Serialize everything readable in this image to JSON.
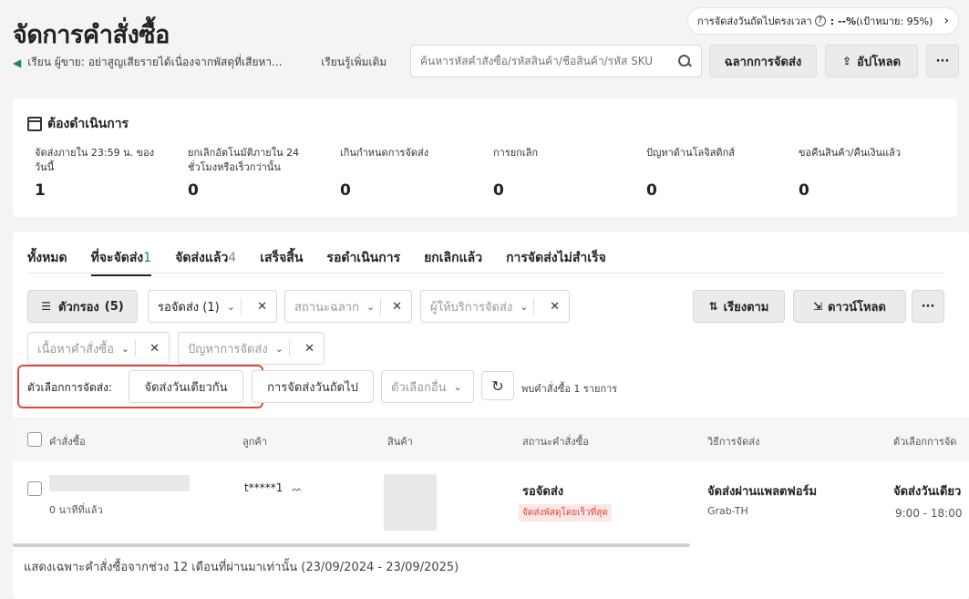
{
  "header": {
    "title": "จัดการคำสั่งซื้อ",
    "sla": {
      "label": "การจัดส่งวันถัดไปตรงเวลา",
      "help": "?",
      "value": ": --%",
      "target": " (เป้าหมาย: 95%)",
      "chevron": "›"
    },
    "notice": {
      "text": "เรียน ผู้ขาย: อย่าสูญเสียรายได้เนื่องจากพัสดุที่เสียหา...",
      "learn_more": "เรียนรู้เพิ่มเติม"
    },
    "search": {
      "placeholder": "ค้นหารหัสคำสั่งซื้อ/รหัสสินค้า/ชื่อสินค้า/รหัส SKU"
    },
    "buttons": {
      "label": "ฉลากการจัดส่ง",
      "upload": "อัปโหลด",
      "more": "···"
    }
  },
  "todo": {
    "title": "ต้องดำเนินการ",
    "items": [
      {
        "label": "จัดส่งภายใน 23:59 น. ของวันนี้",
        "value": "1"
      },
      {
        "label": "ยกเลิกอัตโนมัติภายใน 24 ชั่วโมงหรือเร็วกว่านั้น",
        "value": "0"
      },
      {
        "label": "เกินกำหนดการจัดส่ง",
        "value": "0"
      },
      {
        "label": "การยกเลิก",
        "value": "0"
      },
      {
        "label": "ปัญหาด้านโลจิสติกส์",
        "value": "0"
      },
      {
        "label": "ขอคืนสินค้า/คืนเงินแล้ว",
        "value": "0"
      }
    ]
  },
  "tabs": [
    {
      "label": "ทั้งหมด",
      "count": ""
    },
    {
      "label": "ที่จะจัดส่ง",
      "count": "1"
    },
    {
      "label": "จัดส่งแล้ว",
      "count": "4"
    },
    {
      "label": "เสร็จสิ้น",
      "count": ""
    },
    {
      "label": "รอดำเนินการ",
      "count": ""
    },
    {
      "label": "ยกเลิกแล้ว",
      "count": ""
    },
    {
      "label": "การจัดส่งไม่สำเร็จ",
      "count": ""
    }
  ],
  "filters": {
    "filter_button": "ตัวกรอง",
    "filter_count": "(5)",
    "to_ship": "รอจัดส่ง (1)",
    "label_status": "สถานะฉลาก",
    "provider": "ผู้ให้บริการจัดส่ง",
    "order_content": "เนื้อหาคำสั่งซื้อ",
    "shipping_issue": "ปัญหาการจัดส่ง",
    "sort": "เรียงตาม",
    "download": "ดาวน์โหลด",
    "more": "···"
  },
  "shipping_options": {
    "label": "ตัวเลือกการจัดส่ง:",
    "same_day": "จัดส่งวันเดียวกัน",
    "next_day": "การจัดส่งวันถัดไป",
    "other": "ตัวเลือกอื่น",
    "found": "พบคำสั่งซื้อ 1 รายการ"
  },
  "table": {
    "columns": [
      "คำสั่งซื้อ",
      "ลูกค้า",
      "สินค้า",
      "สถานะคำสั่งซื้อ",
      "วิธีการจัดส่ง",
      "ตัวเลือกการจัด"
    ],
    "rows": [
      {
        "time": "0 นาทีที่แล้ว",
        "customer": "t*****1",
        "status": "รอจัดส่ง",
        "badge": "จัดส่งพัสดุโดยเร็วที่สุด",
        "method": "จัดส่งผ่านแพลตฟอร์ม",
        "carrier": "Grab-TH",
        "option": "จัดส่งวันเดียว",
        "window": "9:00 - 18:00"
      }
    ]
  },
  "footer": "แสดงเฉพาะคำสั่งซื้อจากช่วง 12 เดือนที่ผ่านมาเท่านั้น (23/09/2024 - 23/09/2025)"
}
